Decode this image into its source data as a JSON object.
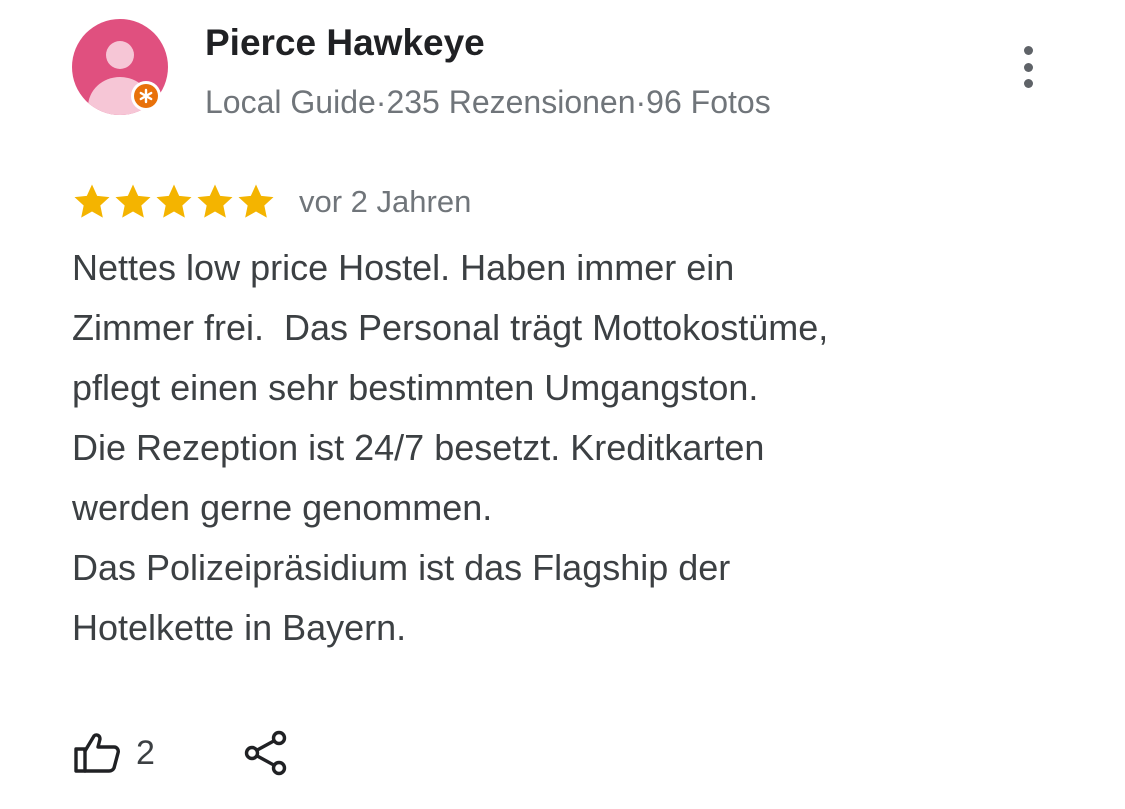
{
  "reviewer": {
    "name": "Pierce Hawkeye",
    "badge": "Local Guide",
    "meta_separator": "·",
    "reviews": "235 Rezensionen",
    "photos": "96 Fotos"
  },
  "review": {
    "rating": 5,
    "max_rating": 5,
    "date": "vor 2 Jahren",
    "lines": [
      "Nettes low price Hostel. Haben immer ein",
      "Zimmer frei.  Das Personal trägt Mottokostüme,",
      "pflegt einen sehr bestimmten Umgangston.",
      "Die Rezeption ist 24/7 besetzt. Kreditkarten",
      "werden gerne genommen.",
      "Das Polizeipräsidium ist das Flagship der",
      "Hotelkette in Bayern."
    ]
  },
  "actions": {
    "like_count": "2",
    "like_icon": "thumbs-up-icon",
    "share_icon": "share-icon",
    "more_icon": "more-vert-icon"
  },
  "colors": {
    "star": "#f4b400",
    "avatar": "#e0507f",
    "guide_badge": "#e8710a",
    "meta_text": "#70757a"
  }
}
